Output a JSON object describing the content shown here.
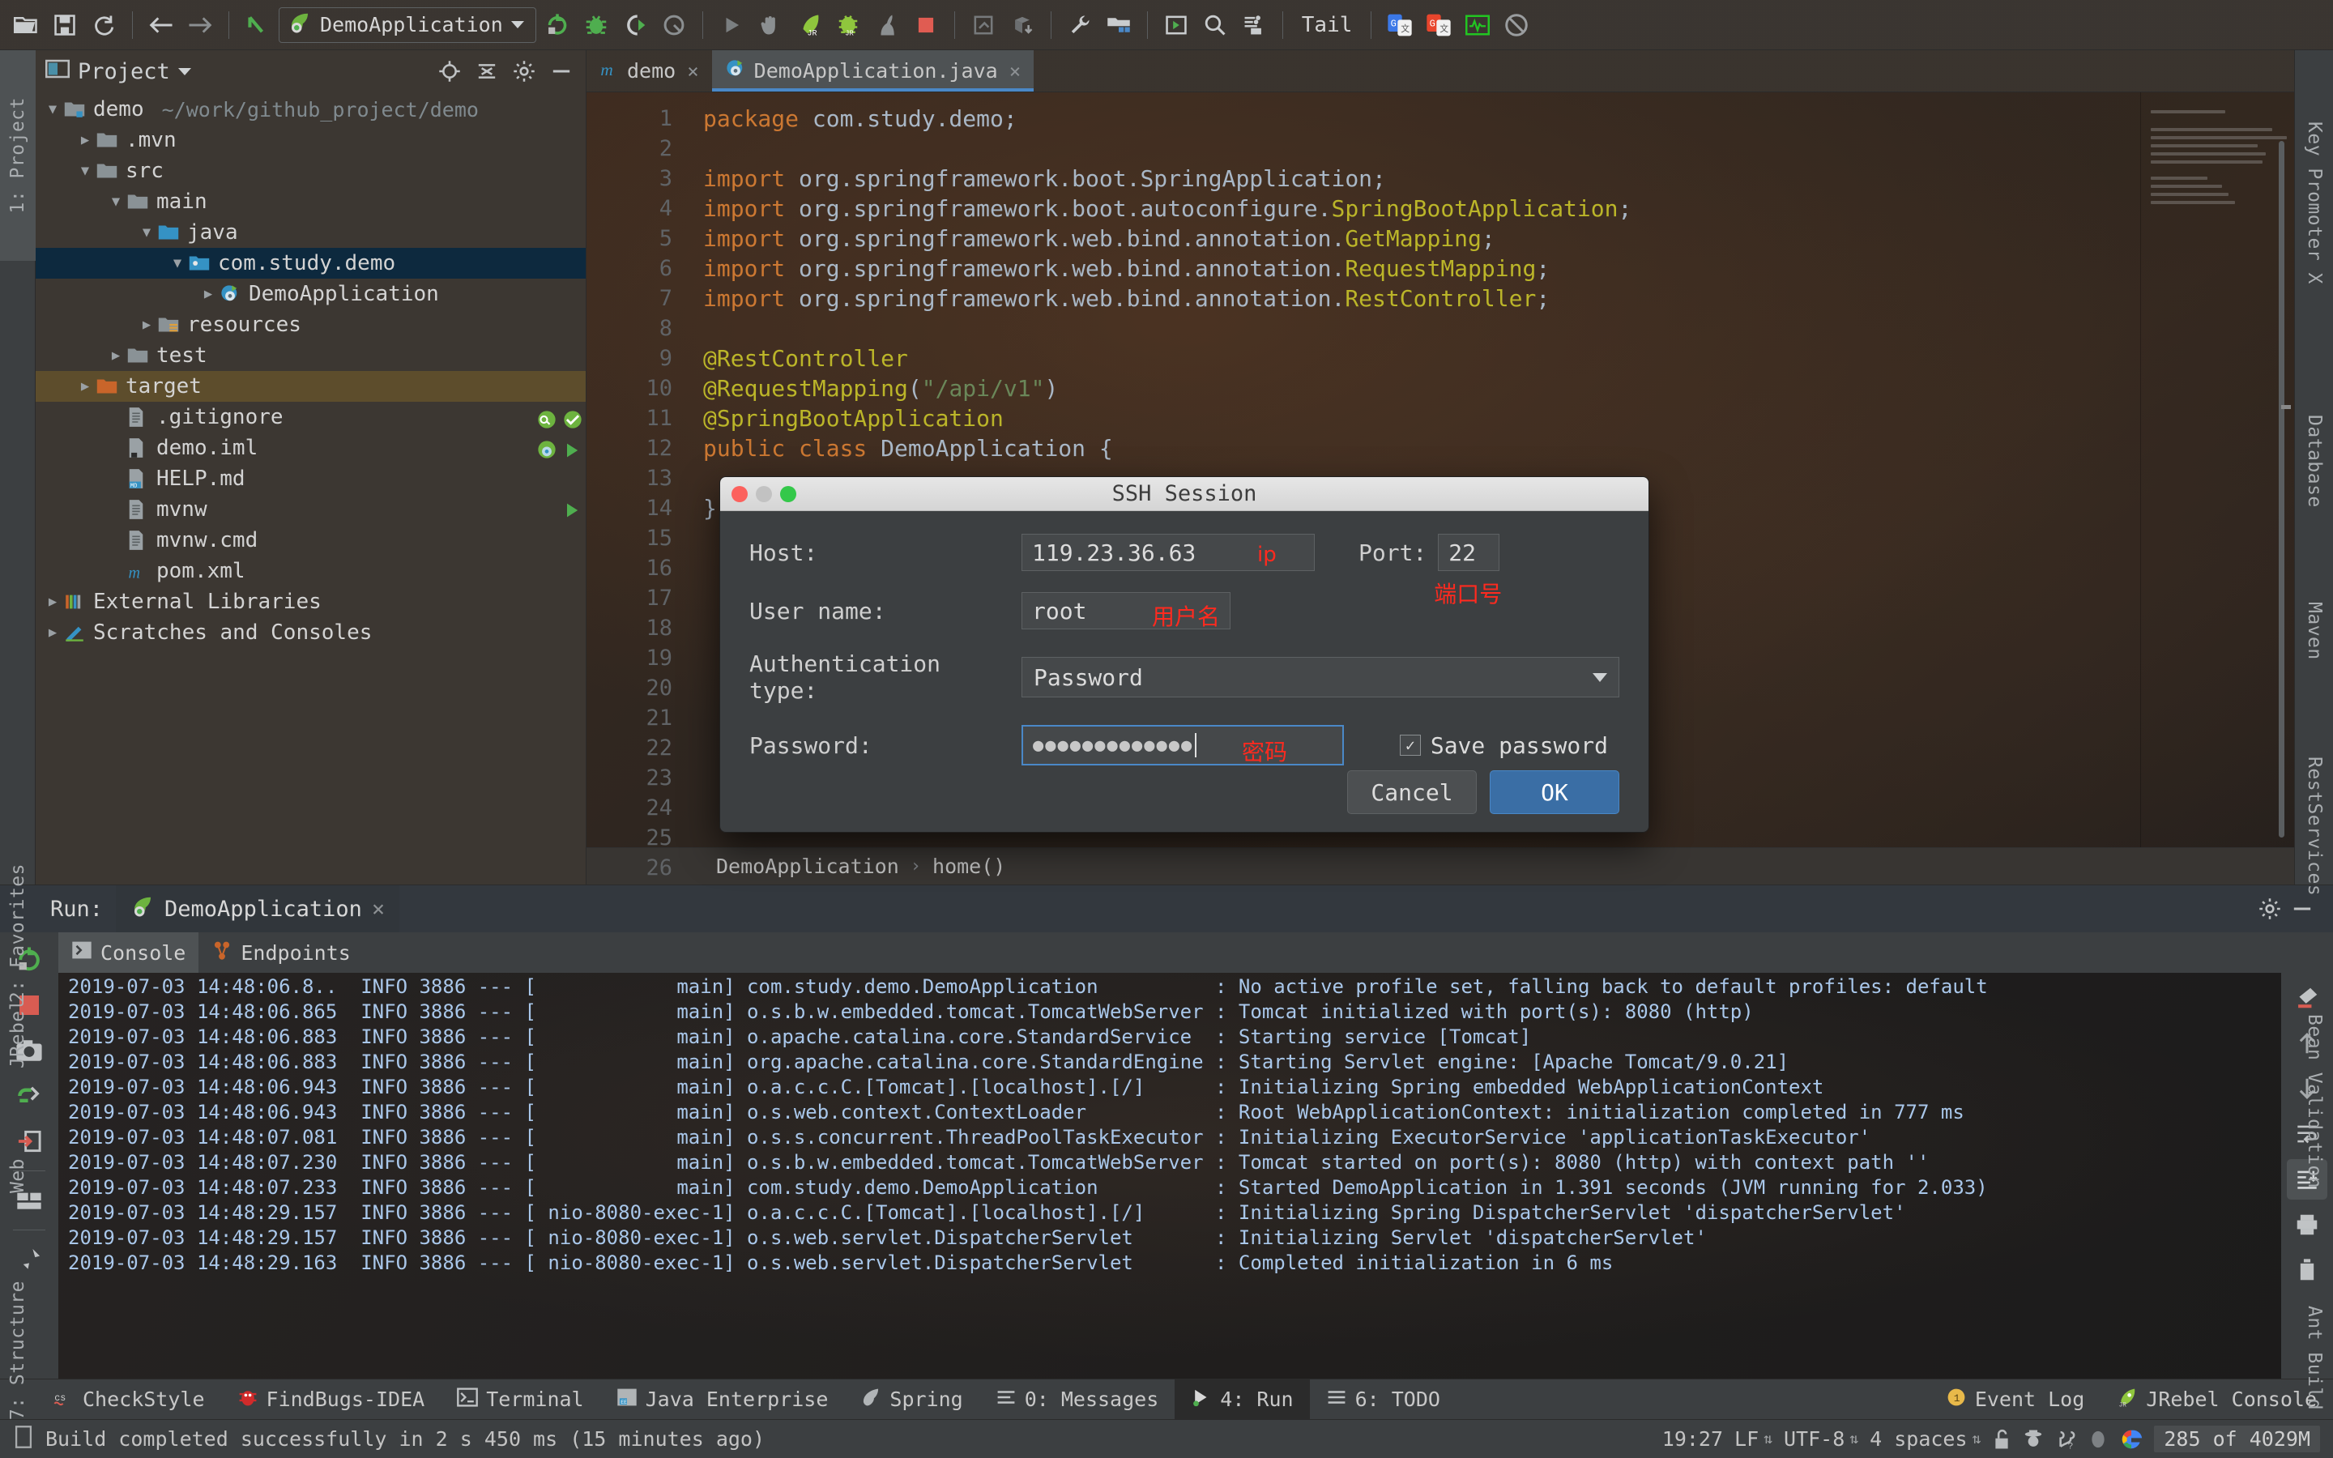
{
  "toolbar": {
    "run_config": "DemoApplication",
    "tail_label": "Tail",
    "icons": [
      "open-folder-icon",
      "save-icon",
      "sync-icon",
      "back-arrow-icon",
      "forward-arrow-icon",
      "undo-icon",
      "run-config-icon",
      "rerun-icon",
      "debug-icon",
      "run-with-coverage-icon",
      "profile-icon",
      "run-icon",
      "stop-hand-icon",
      "jrebel-run-icon",
      "jrebel-debug-icon",
      "rabbit-icon",
      "stop-icon",
      "update-app-icon",
      "package-down-icon",
      "wrench-icon",
      "project-structure-icon",
      "console-run-icon",
      "search-icon",
      "database-save-icon",
      "google-translate-icon",
      "translate-red-icon",
      "monitor-icon",
      "no-entry-icon"
    ]
  },
  "left_strip": {
    "tabs": [
      {
        "label": "1: Project",
        "icon": "project-folder-icon",
        "selected": true
      },
      {
        "label": "2: Favorites",
        "icon": "star-icon",
        "selected": false
      },
      {
        "label": "JRebel",
        "icon": "jrebel-rocket-icon",
        "selected": false
      },
      {
        "label": "Web",
        "icon": "globe-icon",
        "selected": false
      },
      {
        "label": "7: Structure",
        "icon": "structure-icon",
        "selected": false
      }
    ]
  },
  "right_strip": {
    "tabs": [
      {
        "label": "Key Promoter X",
        "icon": "key-promoter-icon"
      },
      {
        "label": "Database",
        "icon": "database-icon"
      },
      {
        "label": "Maven",
        "icon": "maven-m-icon"
      },
      {
        "label": "RestServices",
        "icon": "rest-services-icon"
      },
      {
        "label": "Bean Validation",
        "icon": "bean-validation-icon"
      },
      {
        "label": "Ant Build",
        "icon": "ant-icon"
      }
    ]
  },
  "project": {
    "title": "Project",
    "header_icons": [
      "locate-icon",
      "collapse-all-icon",
      "gear-icon",
      "minimize-icon"
    ],
    "tree": [
      {
        "depth": 0,
        "arrow": "▼",
        "icon": "module-folder-icon",
        "label": "demo",
        "path": "~/work/github_project/demo",
        "state": "normal"
      },
      {
        "depth": 1,
        "arrow": "▶",
        "icon": "folder-icon",
        "label": ".mvn",
        "path": "",
        "state": "normal"
      },
      {
        "depth": 1,
        "arrow": "▼",
        "icon": "folder-icon",
        "label": "src",
        "path": "",
        "state": "normal"
      },
      {
        "depth": 2,
        "arrow": "▼",
        "icon": "folder-icon",
        "label": "main",
        "path": "",
        "state": "normal"
      },
      {
        "depth": 3,
        "arrow": "▼",
        "icon": "source-folder-icon",
        "label": "java",
        "path": "",
        "state": "normal"
      },
      {
        "depth": 4,
        "arrow": "▼",
        "icon": "package-icon",
        "label": "com.study.demo",
        "path": "",
        "state": "selected"
      },
      {
        "depth": 5,
        "arrow": "▶",
        "icon": "spring-class-icon",
        "label": "DemoApplication",
        "path": "",
        "state": "normal"
      },
      {
        "depth": 3,
        "arrow": "▶",
        "icon": "resources-folder-icon",
        "label": "resources",
        "path": "",
        "state": "normal"
      },
      {
        "depth": 2,
        "arrow": "▶",
        "icon": "folder-icon",
        "label": "test",
        "path": "",
        "state": "normal"
      },
      {
        "depth": 1,
        "arrow": "▶",
        "icon": "target-folder-icon",
        "label": "target",
        "path": "",
        "state": "highlighted"
      },
      {
        "depth": 2,
        "arrow": "",
        "icon": "file-icon",
        "label": ".gitignore",
        "path": "",
        "state": "normal"
      },
      {
        "depth": 2,
        "arrow": "",
        "icon": "iml-file-icon",
        "label": "demo.iml",
        "path": "",
        "state": "normal"
      },
      {
        "depth": 2,
        "arrow": "",
        "icon": "markdown-file-icon",
        "label": "HELP.md",
        "path": "",
        "state": "normal"
      },
      {
        "depth": 2,
        "arrow": "",
        "icon": "file-icon",
        "label": "mvnw",
        "path": "",
        "state": "normal"
      },
      {
        "depth": 2,
        "arrow": "",
        "icon": "file-icon",
        "label": "mvnw.cmd",
        "path": "",
        "state": "normal"
      },
      {
        "depth": 2,
        "arrow": "",
        "icon": "maven-m-icon",
        "label": "pom.xml",
        "path": "",
        "state": "normal"
      },
      {
        "depth": 0,
        "arrow": "▶",
        "icon": "libraries-icon",
        "label": "External Libraries",
        "path": "",
        "state": "normal"
      },
      {
        "depth": 0,
        "arrow": "▶",
        "icon": "scratches-icon",
        "label": "Scratches and Consoles",
        "path": "",
        "state": "normal"
      }
    ]
  },
  "editor": {
    "tabs": [
      {
        "label": "demo",
        "icon": "maven-m-icon",
        "selected": false
      },
      {
        "label": "DemoApplication.java",
        "icon": "spring-class-icon",
        "selected": true
      }
    ],
    "line_numbers": [
      1,
      2,
      3,
      4,
      5,
      6,
      7,
      8,
      9,
      10,
      11,
      12,
      13,
      14,
      15,
      16,
      17,
      18,
      19,
      20,
      21,
      22,
      23,
      24,
      25,
      26
    ],
    "lines": [
      {
        "n": 1,
        "tokens": [
          {
            "t": "package ",
            "c": "kw"
          },
          {
            "t": "com.study.demo;",
            "c": "plain"
          }
        ]
      },
      {
        "n": 2,
        "tokens": []
      },
      {
        "n": 3,
        "tokens": [
          {
            "t": "import ",
            "c": "kw"
          },
          {
            "t": "org.springframework.boot.",
            "c": "plain"
          },
          {
            "t": "SpringApplication",
            "c": "plain"
          },
          {
            "t": ";",
            "c": "plain"
          }
        ]
      },
      {
        "n": 4,
        "tokens": [
          {
            "t": "import ",
            "c": "kw"
          },
          {
            "t": "org.springframework.boot.autoconfigure.",
            "c": "plain"
          },
          {
            "t": "SpringBootApplication",
            "c": "ann"
          },
          {
            "t": ";",
            "c": "plain"
          }
        ]
      },
      {
        "n": 5,
        "tokens": [
          {
            "t": "import ",
            "c": "kw"
          },
          {
            "t": "org.springframework.web.bind.annotation.",
            "c": "plain"
          },
          {
            "t": "GetMapping",
            "c": "ann"
          },
          {
            "t": ";",
            "c": "plain"
          }
        ]
      },
      {
        "n": 6,
        "tokens": [
          {
            "t": "import ",
            "c": "kw"
          },
          {
            "t": "org.springframework.web.bind.annotation.",
            "c": "plain"
          },
          {
            "t": "RequestMapping",
            "c": "ann"
          },
          {
            "t": ";",
            "c": "plain"
          }
        ]
      },
      {
        "n": 7,
        "tokens": [
          {
            "t": "import ",
            "c": "kw"
          },
          {
            "t": "org.springframework.web.bind.annotation.",
            "c": "plain"
          },
          {
            "t": "RestController",
            "c": "ann"
          },
          {
            "t": ";",
            "c": "plain"
          }
        ]
      },
      {
        "n": 8,
        "tokens": []
      },
      {
        "n": 9,
        "tokens": [
          {
            "t": "@RestController",
            "c": "ann"
          }
        ]
      },
      {
        "n": 10,
        "tokens": [
          {
            "t": "@RequestMapping",
            "c": "ann"
          },
          {
            "t": "(",
            "c": "plain"
          },
          {
            "t": "\"/api/v1\"",
            "c": "str"
          },
          {
            "t": ")",
            "c": "plain"
          }
        ]
      },
      {
        "n": 11,
        "tokens": [
          {
            "t": "@SpringBootApplication",
            "c": "ann"
          }
        ]
      },
      {
        "n": 12,
        "tokens": [
          {
            "t": "public class ",
            "c": "kw"
          },
          {
            "t": "DemoApplication",
            "c": "plain"
          },
          {
            "t": " {",
            "c": "plain"
          }
        ]
      },
      {
        "n": 25,
        "tokens": [
          {
            "t": "}",
            "c": "plain"
          }
        ]
      }
    ],
    "code_text_1": "package com.study.demo;",
    "breadcrumb": [
      "DemoApplication",
      "home()"
    ],
    "breadcrumb_sep": "›"
  },
  "ssh_dialog": {
    "title": "SSH Session",
    "host_label": "Host:",
    "host_value": "119.23.36.63",
    "host_annotation": "ip",
    "port_label": "Port:",
    "port_value": "22",
    "port_annotation": "端口号",
    "username_label": "User name:",
    "username_value": "root",
    "username_annotation": "用户名",
    "auth_label": "Authentication type:",
    "auth_value": "Password",
    "password_label": "Password:",
    "password_value": "●●●●●●●●●●●●●",
    "password_annotation": "密码",
    "save_password_label": "Save password",
    "save_password_checked": "✓",
    "cancel_label": "Cancel",
    "ok_label": "OK",
    "accent_color": "#3a6ea5",
    "annotation_color": "#ff2a1f"
  },
  "run_panel": {
    "run_label": "Run:",
    "config_name": "DemoApplication",
    "close_x": "×",
    "tabs": [
      {
        "label": "Console",
        "icon": "console-icon",
        "selected": true
      },
      {
        "label": "Endpoints",
        "icon": "endpoints-icon",
        "selected": false
      }
    ],
    "gutter_icons": [
      "rerun-icon",
      "stop-icon",
      "camera-icon",
      "restart-frame-icon",
      "exit-icon",
      "layout-icon",
      "pin-icon"
    ],
    "side_icons": [
      "highlight-icon",
      "up-arrow-icon",
      "down-arrow-icon",
      "soft-wrap-icon",
      "scroll-to-end-icon",
      "print-icon",
      "trash-icon"
    ],
    "header_icons": [
      "gear-icon",
      "minimize-icon"
    ],
    "log_lines": [
      {
        "ts": "2019-07-03 14:48:06.8..",
        "lvl": "INFO",
        "pid": "3886",
        "thread": "main",
        "logger": "com.study.demo.DemoApplication",
        "msg": "No active profile set, falling back to default profiles: default",
        "partial": true
      },
      {
        "ts": "2019-07-03 14:48:06.865",
        "lvl": "INFO",
        "pid": "3886",
        "thread": "main",
        "logger": "o.s.b.w.embedded.tomcat.TomcatWebServer",
        "msg": "Tomcat initialized with port(s): 8080 (http)"
      },
      {
        "ts": "2019-07-03 14:48:06.883",
        "lvl": "INFO",
        "pid": "3886",
        "thread": "main",
        "logger": "o.apache.catalina.core.StandardService",
        "msg": "Starting service [Tomcat]"
      },
      {
        "ts": "2019-07-03 14:48:06.883",
        "lvl": "INFO",
        "pid": "3886",
        "thread": "main",
        "logger": "org.apache.catalina.core.StandardEngine",
        "msg": "Starting Servlet engine: [Apache Tomcat/9.0.21]"
      },
      {
        "ts": "2019-07-03 14:48:06.943",
        "lvl": "INFO",
        "pid": "3886",
        "thread": "main",
        "logger": "o.a.c.c.C.[Tomcat].[localhost].[/]",
        "msg": "Initializing Spring embedded WebApplicationContext"
      },
      {
        "ts": "2019-07-03 14:48:06.943",
        "lvl": "INFO",
        "pid": "3886",
        "thread": "main",
        "logger": "o.s.web.context.ContextLoader",
        "msg": "Root WebApplicationContext: initialization completed in 777 ms"
      },
      {
        "ts": "2019-07-03 14:48:07.081",
        "lvl": "INFO",
        "pid": "3886",
        "thread": "main",
        "logger": "o.s.s.concurrent.ThreadPoolTaskExecutor",
        "msg": "Initializing ExecutorService 'applicationTaskExecutor'"
      },
      {
        "ts": "2019-07-03 14:48:07.230",
        "lvl": "INFO",
        "pid": "3886",
        "thread": "main",
        "logger": "o.s.b.w.embedded.tomcat.TomcatWebServer",
        "msg": "Tomcat started on port(s): 8080 (http) with context path ''"
      },
      {
        "ts": "2019-07-03 14:48:07.233",
        "lvl": "INFO",
        "pid": "3886",
        "thread": "main",
        "logger": "com.study.demo.DemoApplication",
        "msg": "Started DemoApplication in 1.391 seconds (JVM running for 2.033)"
      },
      {
        "ts": "2019-07-03 14:48:29.157",
        "lvl": "INFO",
        "pid": "3886",
        "thread": "nio-8080-exec-1",
        "logger": "o.a.c.c.C.[Tomcat].[localhost].[/]",
        "msg": "Initializing Spring DispatcherServlet 'dispatcherServlet'"
      },
      {
        "ts": "2019-07-03 14:48:29.157",
        "lvl": "INFO",
        "pid": "3886",
        "thread": "nio-8080-exec-1",
        "logger": "o.s.web.servlet.DispatcherServlet",
        "msg": "Initializing Servlet 'dispatcherServlet'"
      },
      {
        "ts": "2019-07-03 14:48:29.163",
        "lvl": "INFO",
        "pid": "3886",
        "thread": "nio-8080-exec-1",
        "logger": "o.s.web.servlet.DispatcherServlet",
        "msg": "Completed initialization in 6 ms"
      }
    ]
  },
  "tool_strip": {
    "left_items": [
      {
        "label": "CheckStyle",
        "icon": "checkstyle-icon"
      },
      {
        "label": "FindBugs-IDEA",
        "icon": "findbugs-icon"
      },
      {
        "label": "Terminal",
        "icon": "terminal-icon"
      },
      {
        "label": "Java Enterprise",
        "icon": "java-enterprise-icon"
      },
      {
        "label": "Spring",
        "icon": "spring-leaf-icon"
      },
      {
        "label": "0: Messages",
        "icon": "messages-icon"
      },
      {
        "label": "4: Run",
        "icon": "run-icon",
        "selected": true
      },
      {
        "label": "6: TODO",
        "icon": "todo-icon"
      }
    ],
    "right_items": [
      {
        "label": "Event Log",
        "icon": "event-log-icon"
      },
      {
        "label": "JRebel Console",
        "icon": "jrebel-rocket-icon"
      }
    ]
  },
  "status_bar": {
    "build_message": "Build completed successfully in 2 s 450 ms (15 minutes ago)",
    "caret_position": "19:27",
    "line_separator": "LF",
    "encoding": "UTF-8",
    "indent": "4 spaces",
    "memory": "285 of 4029M",
    "icons": [
      "build-icon",
      "lock-open-icon",
      "hector-icon",
      "vcs-branch-icon",
      "notification-icon",
      "google-icon"
    ]
  }
}
